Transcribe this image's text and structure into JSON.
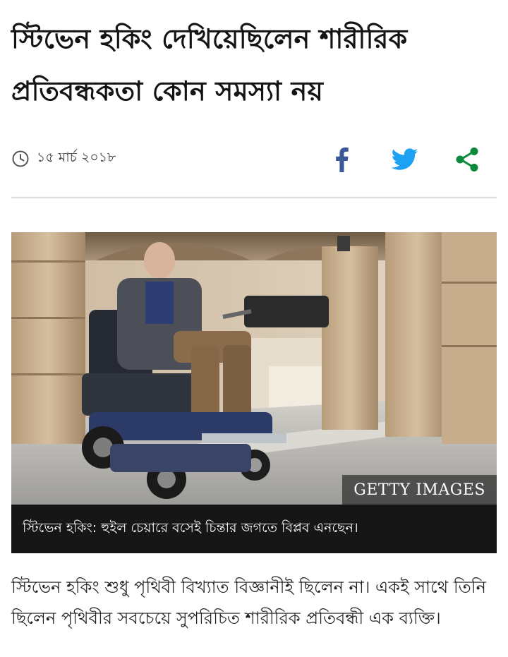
{
  "article": {
    "headline": "স্টিভেন হকিং দেখিয়েছিলেন শারীরিক প্রতিবন্ধকতা কোন সমস্যা নয়",
    "date": "১৫ মার্চ ২০১৮",
    "figure": {
      "credit": "GETTY IMAGES",
      "caption": "স্টিভেন হকিং: হুইল চেয়ারে বসেই চিন্তার জগতে বিপ্লব এনছেন।"
    },
    "intro": "স্টিভেন হকিং শুধু পৃথিবী বিখ্যাত বিজ্ঞানীই ছিলেন না। একই সাথে তিনি ছিলেন পৃথিবীর সবচেয়ে সুপরিচিত শারীরিক প্রতিবন্ধী এক ব্যক্তি।"
  },
  "share": {
    "icons": [
      "facebook-icon",
      "twitter-icon",
      "share-icon"
    ],
    "colors": {
      "facebook": "#3b5998",
      "twitter": "#1da1f2",
      "share": "#0a8a3a"
    }
  }
}
